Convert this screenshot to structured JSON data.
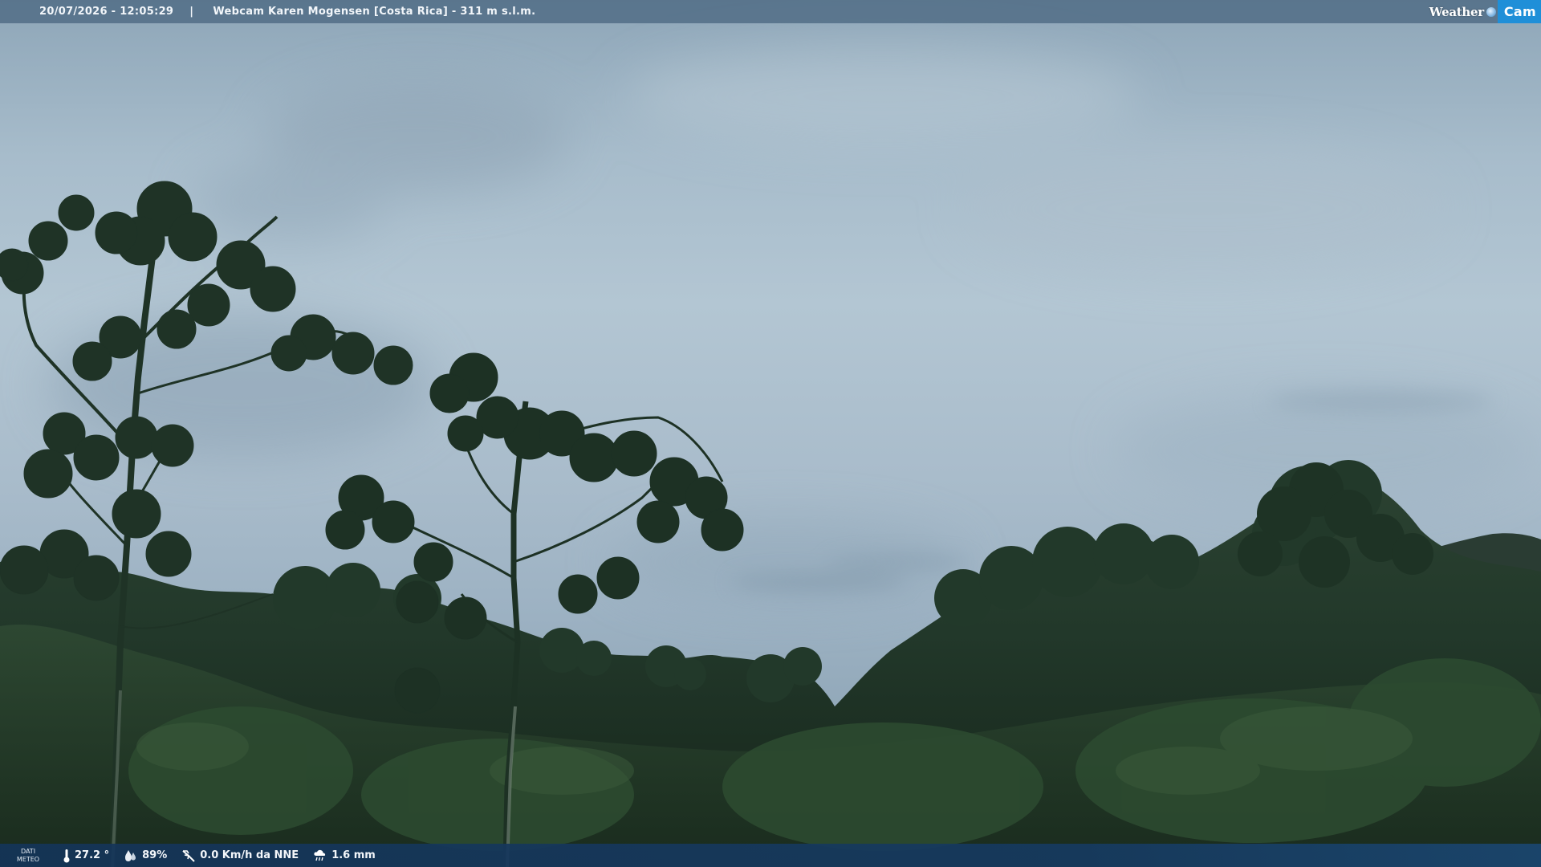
{
  "header": {
    "timestamp": "20/07/2026 - 12:05:29",
    "separator": "|",
    "camera_title": "Webcam Karen Mogensen [Costa Rica] - 311 m s.l.m.",
    "brand_weather": "Weather",
    "brand_cam": "Cam",
    "brand_colors": {
      "cam_box": "#1f8fd8"
    }
  },
  "weather_bar": {
    "section_label": "DATI\nMETEO",
    "section_label_line1": "DATI",
    "section_label_line2": "METEO",
    "temperature": "27.2 °",
    "humidity": "89%",
    "wind": "0.0 Km/h da NNE",
    "rain": "1.6 mm",
    "icons": [
      "thermometer-icon",
      "humidity-drops-icon",
      "wind-vane-icon",
      "rain-cloud-icon"
    ]
  },
  "scene": {
    "colors": {
      "sky_top": "#8ea6b8",
      "sky_mid": "#b3c6d3",
      "foliage_dark": "#17291b",
      "foliage_mid": "#24402a",
      "tree_silhouette": "#1e3426"
    }
  }
}
